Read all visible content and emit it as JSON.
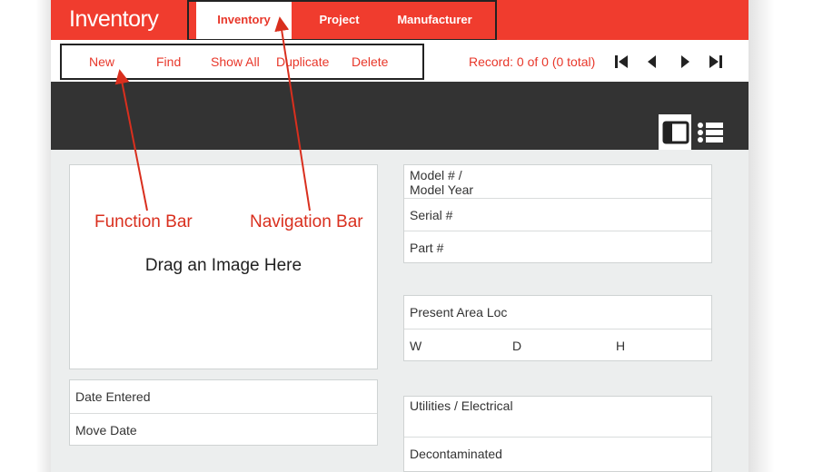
{
  "app": {
    "title": "Inventory"
  },
  "nav": {
    "tabs": [
      {
        "label": "Inventory",
        "active": true
      },
      {
        "label": "Project",
        "active": false
      },
      {
        "label": "Manufacturer",
        "active": false
      }
    ]
  },
  "functions": {
    "new": "New",
    "find": "Find",
    "show_all": "Show All",
    "duplicate": "Duplicate",
    "delete": "Delete"
  },
  "record": {
    "status": "Record: 0 of 0 (0 total)"
  },
  "record_nav_icons": [
    "first-record-icon",
    "previous-record-icon",
    "next-record-icon",
    "last-record-icon"
  ],
  "view_icons": [
    "form-view-icon",
    "list-view-icon"
  ],
  "image": {
    "drop_label": "Drag an Image Here"
  },
  "dates": {
    "entered": "Date Entered",
    "move": "Move Date"
  },
  "identifiers": {
    "model_line1": "Model # /",
    "model_line2": "Model Year",
    "serial": "Serial #",
    "part": "Part #"
  },
  "location": {
    "present_area": "Present Area Loc",
    "w": "W",
    "d": "D",
    "h": "H"
  },
  "utilities": {
    "electrical": "Utilities / Electrical",
    "decontaminated": "Decontaminated"
  },
  "annotations": {
    "function_bar": "Function Bar",
    "navigation_bar": "Navigation Bar"
  },
  "colors": {
    "accent": "#f03c2e",
    "accent_text": "#e8372a",
    "dark_band": "#333333",
    "annotation": "#d92f1e"
  }
}
